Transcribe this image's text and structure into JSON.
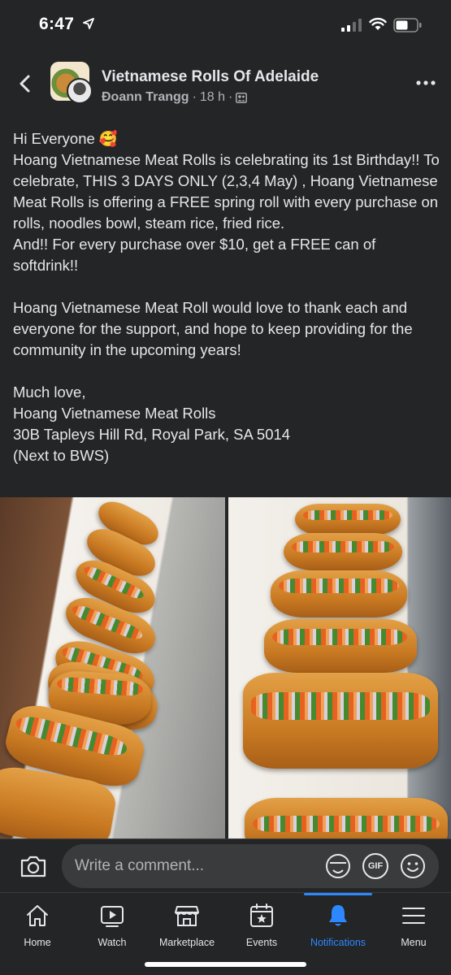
{
  "status_bar": {
    "time": "6:47"
  },
  "post": {
    "group_name": "Vietnamese Rolls Of Adelaide",
    "author": "Đoann Trangg",
    "separator": "·",
    "time_ago": "18 h",
    "separator2": "·",
    "paragraphs": [
      "Hi Everyone 🥰\nHoang Vietnamese Meat Rolls is celebrating its 1st Birthday!! To celebrate, THIS 3 DAYS ONLY (2,3,4 May) , Hoang Vietnamese Meat Rolls is offering a FREE spring roll with every purchase on rolls, noodles bowl, steam rice, fried rice.\nAnd!! For every purchase over $10, get a FREE can of softdrink!!",
      "Hoang Vietnamese Meat Roll would love to thank each and everyone for the support, and hope to keep providing for the community in the upcoming years!",
      "Much love,\nHoang Vietnamese Meat Rolls\n30B Tapleys Hill Rd, Royal Park, SA 5014\n(Next to BWS)"
    ]
  },
  "comment_bar": {
    "placeholder": "Write a comment...",
    "gif_label": "GIF"
  },
  "tabs": [
    {
      "label": "Home",
      "icon": "home-icon"
    },
    {
      "label": "Watch",
      "icon": "watch-icon"
    },
    {
      "label": "Marketplace",
      "icon": "marketplace-icon"
    },
    {
      "label": "Events",
      "icon": "events-icon"
    },
    {
      "label": "Notifications",
      "icon": "bell-icon",
      "active": true
    },
    {
      "label": "Menu",
      "icon": "menu-icon"
    }
  ],
  "colors": {
    "background": "#242526",
    "accent": "#2d88ff",
    "text": "#e4e6eb",
    "secondary_text": "#b0b3b8"
  }
}
